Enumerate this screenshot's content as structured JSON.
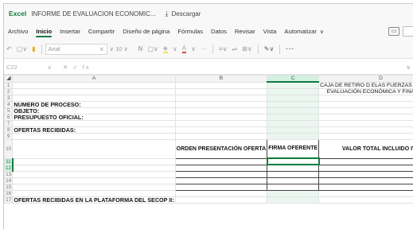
{
  "titlebar": {
    "app_name": "Excel",
    "doc_title": "INFORME DE EVALUACION ECONOMIC...",
    "download_icon": "download-icon",
    "download_label": "Descargar"
  },
  "tabs": [
    "Archivo",
    "Inicio",
    "Insertar",
    "Compartir",
    "Diseño de página",
    "Fórmulas",
    "Datos",
    "Revisar",
    "Vista",
    "Automatizar"
  ],
  "active_tab": "Inicio",
  "toolbar": {
    "undo": "↶",
    "redo_dropdown": "▢∨",
    "format_painter": "▮",
    "font_name": "Arial",
    "font_size": "10",
    "bold": "N",
    "more": "···"
  },
  "formula_bar": {
    "name_box": "C22",
    "cancel": "✕",
    "confirm": "✓",
    "fx": "fx"
  },
  "columns": [
    "A",
    "B",
    "C",
    "D"
  ],
  "selected_column": "C",
  "sheet": {
    "header_line1": "CAJA DE RETIRO D ELAS FUERZAS MILITARES",
    "header_line2": "EVALUACIÓN ECONÓMICA Y FINANCIERA",
    "numero_proceso": "NUMERO DE PROCESO:",
    "objeto": "OBJETO:",
    "presupuesto": "PRESUPUESTO OFICIAL:",
    "ofertas_recibidas": "OFERTAS RECIBIDAS:",
    "col_orden": "ORDEN PRESENTACIÓN OFERTA",
    "col_firma": "FIRMA OFERENTE",
    "col_valor": "VALOR TOTAL INCLUIDO IVA",
    "secop": "OFERTAS RECIBIDAS EN LA PLATAFORMA DEL SECOP II:"
  },
  "row_numbers": [
    "1",
    "2",
    "3",
    "4",
    "5",
    "6",
    "7",
    "8",
    "9",
    "10",
    "11",
    "12",
    "13",
    "14",
    "15",
    "16",
    "17"
  ],
  "colors": {
    "accent": "#107c41",
    "selection_fill": "#d3f0e0"
  }
}
